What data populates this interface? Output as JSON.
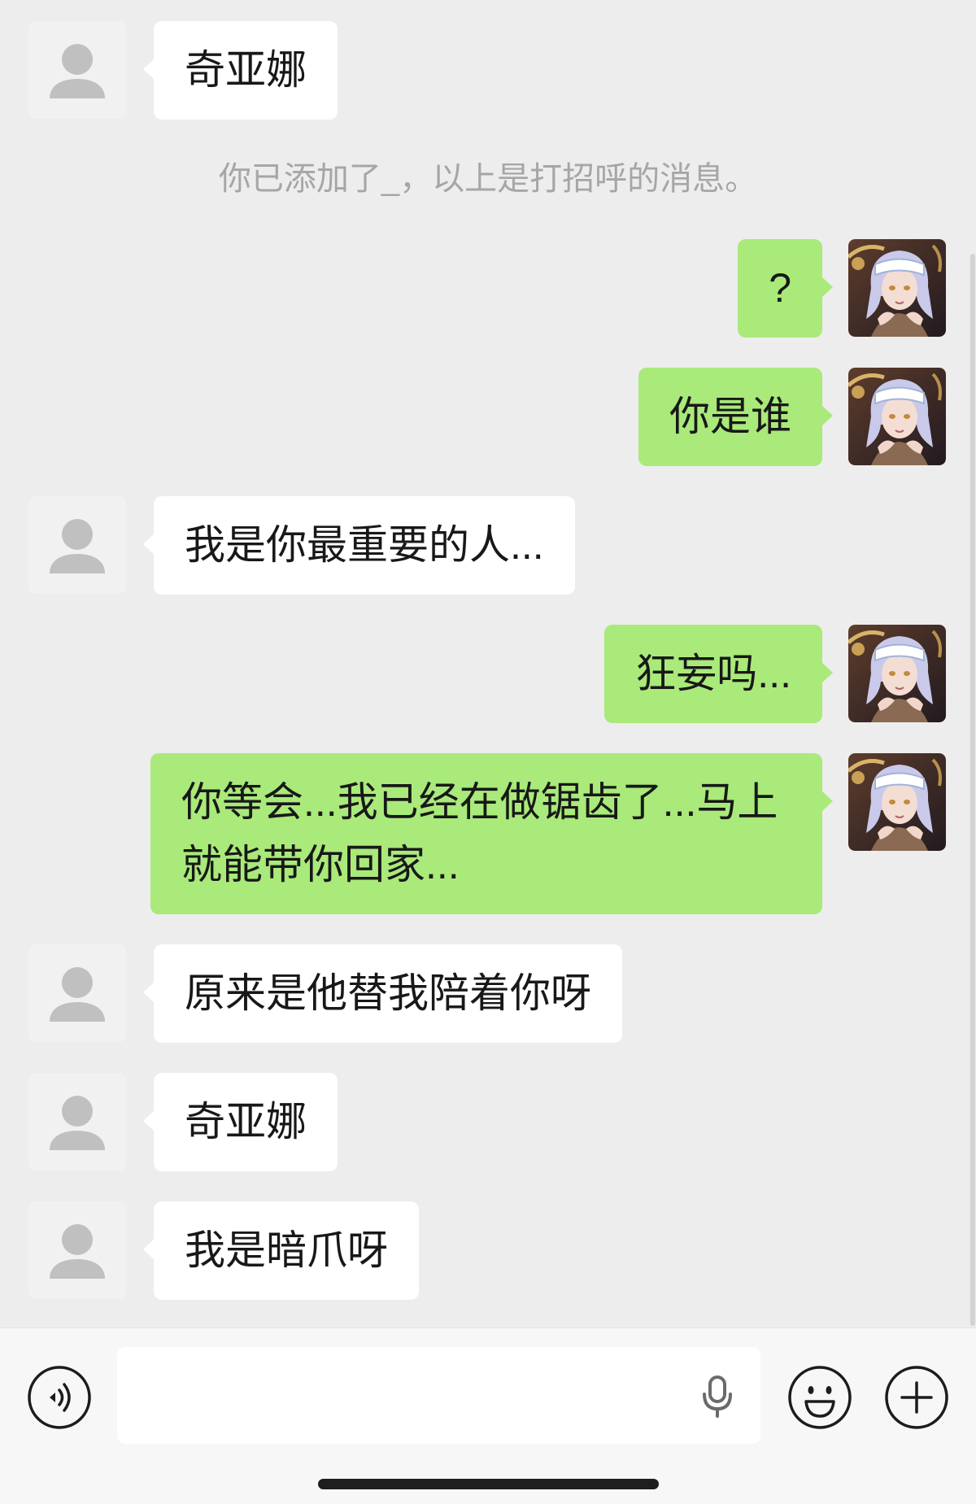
{
  "colors": {
    "background": "#ededed",
    "bubble_incoming": "#ffffff",
    "bubble_outgoing": "#a9ea7a",
    "text": "#181818",
    "system_text": "#a6a6a6",
    "input_bar": "#f7f7f7",
    "icon": "#1c1c1c"
  },
  "avatars": {
    "incoming": "default-avatar-icon",
    "outgoing": "anime-portrait-avatar"
  },
  "messages": [
    {
      "side": "left",
      "text": "奇亚娜"
    },
    {
      "type": "system",
      "text": "你已添加了_，以上是打招呼的消息。"
    },
    {
      "side": "right",
      "text": "?"
    },
    {
      "side": "right",
      "text": "你是谁"
    },
    {
      "side": "left",
      "text": "我是你最重要的人..."
    },
    {
      "side": "right",
      "text": "狂妄吗..."
    },
    {
      "side": "right",
      "text": "你等会...我已经在做锯齿了...马上就能带你回家..."
    },
    {
      "side": "left",
      "text": "原来是他替我陪着你呀"
    },
    {
      "side": "left",
      "text": "奇亚娜"
    },
    {
      "side": "left",
      "text": "我是暗爪呀"
    }
  ],
  "input_bar": {
    "text": "",
    "voice_icon": "voice-icon",
    "mic_icon": "microphone-icon",
    "emoji_icon": "emoji-icon",
    "more_icon": "plus-icon"
  }
}
